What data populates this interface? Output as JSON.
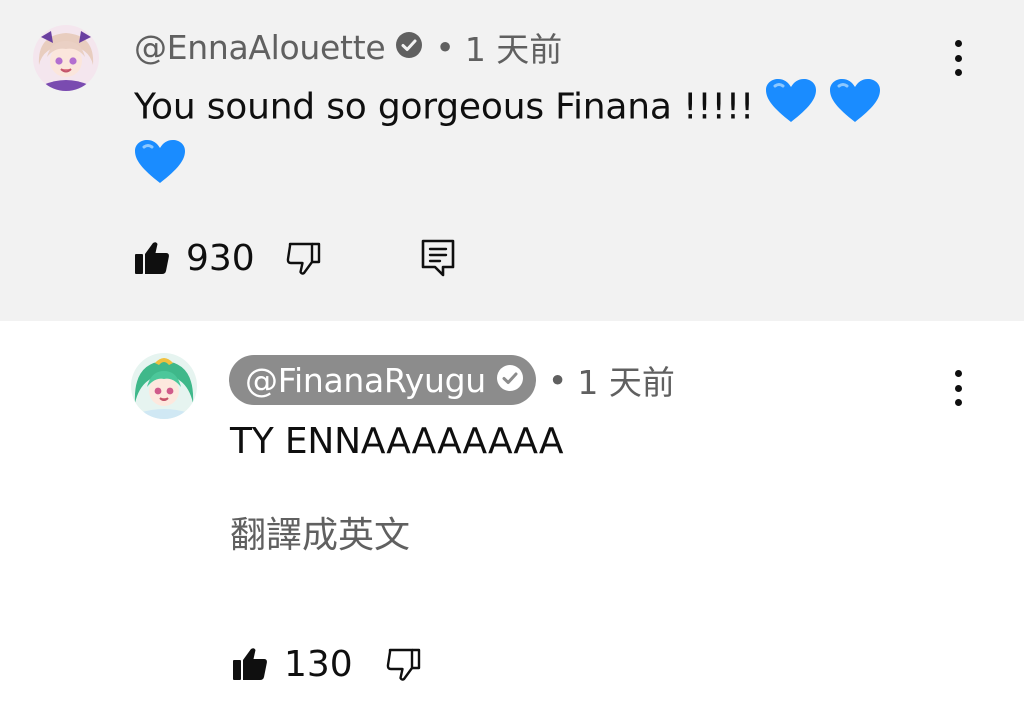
{
  "comment": {
    "handle": "@EnnaAlouette",
    "separator": "•",
    "time": "1 天前",
    "text": "You sound so gorgeous Finana !!!!!",
    "emoji": "blue-heart",
    "likes": "930"
  },
  "reply": {
    "handle": "@FinanaRyugu",
    "separator": "•",
    "time": "1 天前",
    "text": "TY ENNAAAAAAAA",
    "translate_label": "翻譯成英文",
    "likes": "130"
  },
  "colors": {
    "comment_bg": "#f2f2f2",
    "owner_chip_bg": "#8c8c8c",
    "heart_blue": "#1a8cff",
    "text": "#0f0f0f",
    "secondary_text": "#606060"
  }
}
